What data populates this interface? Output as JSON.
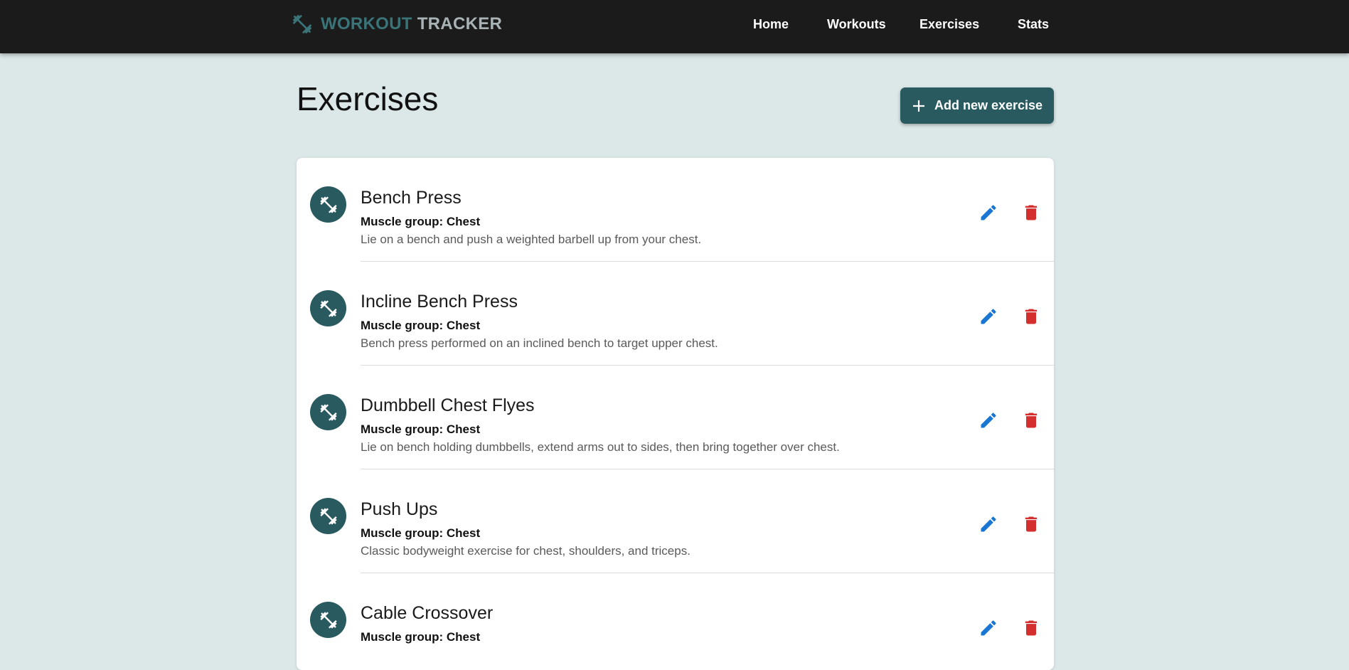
{
  "header": {
    "brand_first": "WORKOUT",
    "brand_second": "TRACKER",
    "nav": [
      "Home",
      "Workouts",
      "Exercises",
      "Stats"
    ]
  },
  "page": {
    "title": "Exercises",
    "add_label": "Add new exercise"
  },
  "exercises": [
    {
      "name": "Bench Press",
      "group": "Muscle group: Chest",
      "description": "Lie on a bench and push a weighted barbell up from your chest."
    },
    {
      "name": "Incline Bench Press",
      "group": "Muscle group: Chest",
      "description": "Bench press performed on an inclined bench to target upper chest."
    },
    {
      "name": "Dumbbell Chest Flyes",
      "group": "Muscle group: Chest",
      "description": "Lie on bench holding dumbbells, extend arms out to sides, then bring together over chest."
    },
    {
      "name": "Push Ups",
      "group": "Muscle group: Chest",
      "description": "Classic bodyweight exercise for chest, shoulders, and triceps."
    },
    {
      "name": "Cable Crossover",
      "group": "Muscle group: Chest",
      "description": ""
    }
  ],
  "colors": {
    "header_bg": "#1b1b1b",
    "page_bg": "#dce7e8",
    "accent": "#285a5f",
    "edit": "#1976d2",
    "delete": "#d32f2f"
  },
  "icons": {
    "brand": "dumbbell-icon",
    "add": "plus-icon",
    "row_avatar": "dumbbell-icon",
    "edit": "pencil-icon",
    "delete": "trash-icon"
  }
}
